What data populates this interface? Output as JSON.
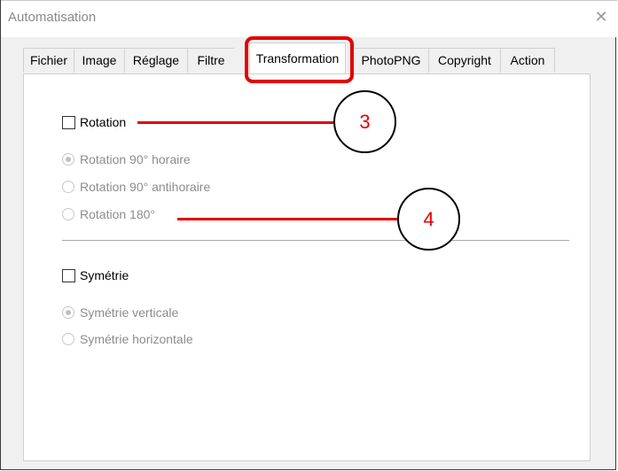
{
  "window": {
    "title": "Automatisation",
    "close_glyph": "✕"
  },
  "tabs": [
    {
      "label": "Fichier"
    },
    {
      "label": "Image"
    },
    {
      "label": "Réglage"
    },
    {
      "label": "Filtre"
    },
    {
      "label": "Transformation",
      "active": true
    },
    {
      "label": "PhotoPNG"
    },
    {
      "label": "Copyright"
    },
    {
      "label": "Action"
    }
  ],
  "rotation": {
    "checkbox_label": "Rotation",
    "checked": false,
    "options": [
      {
        "label": "Rotation 90° horaire",
        "selected": true
      },
      {
        "label": "Rotation 90° antihoraire",
        "selected": false
      },
      {
        "label": "Rotation 180°",
        "selected": false
      }
    ]
  },
  "symmetry": {
    "checkbox_label": "Symétrie",
    "checked": false,
    "options": [
      {
        "label": "Symétrie verticale",
        "selected": true
      },
      {
        "label": "Symétrie horizontale",
        "selected": false
      }
    ]
  },
  "annotations": {
    "callout_3": "3",
    "callout_4": "4",
    "highlight_color": "#e30000"
  }
}
